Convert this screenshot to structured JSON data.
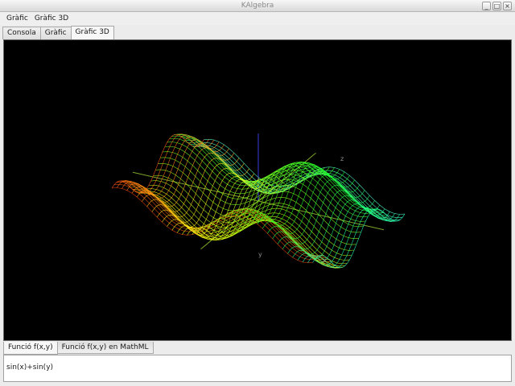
{
  "window": {
    "title": "KAlgebra",
    "minimize": "_",
    "maximize": "□",
    "close": "×"
  },
  "menubar": {
    "items": [
      "Gràfic",
      "Gràfic 3D"
    ]
  },
  "tabs": [
    {
      "label": "Consola",
      "active": false
    },
    {
      "label": "Gràfic",
      "active": false
    },
    {
      "label": "Gràfic 3D",
      "active": true
    }
  ],
  "plot": {
    "function": "sin(x)+sin(y)",
    "axes": {
      "x": "x",
      "y": "y",
      "z": "z"
    },
    "colors": {
      "background": "#000000",
      "axis": "#9acd32",
      "z_axis": "#3a3ae0"
    }
  },
  "input_tabs": [
    {
      "label": "Funció f(x,y)",
      "active": true
    },
    {
      "label": "Funció f(x,y) en MathML",
      "active": false
    }
  ],
  "input": {
    "value": "sin(x)+sin(y)"
  }
}
